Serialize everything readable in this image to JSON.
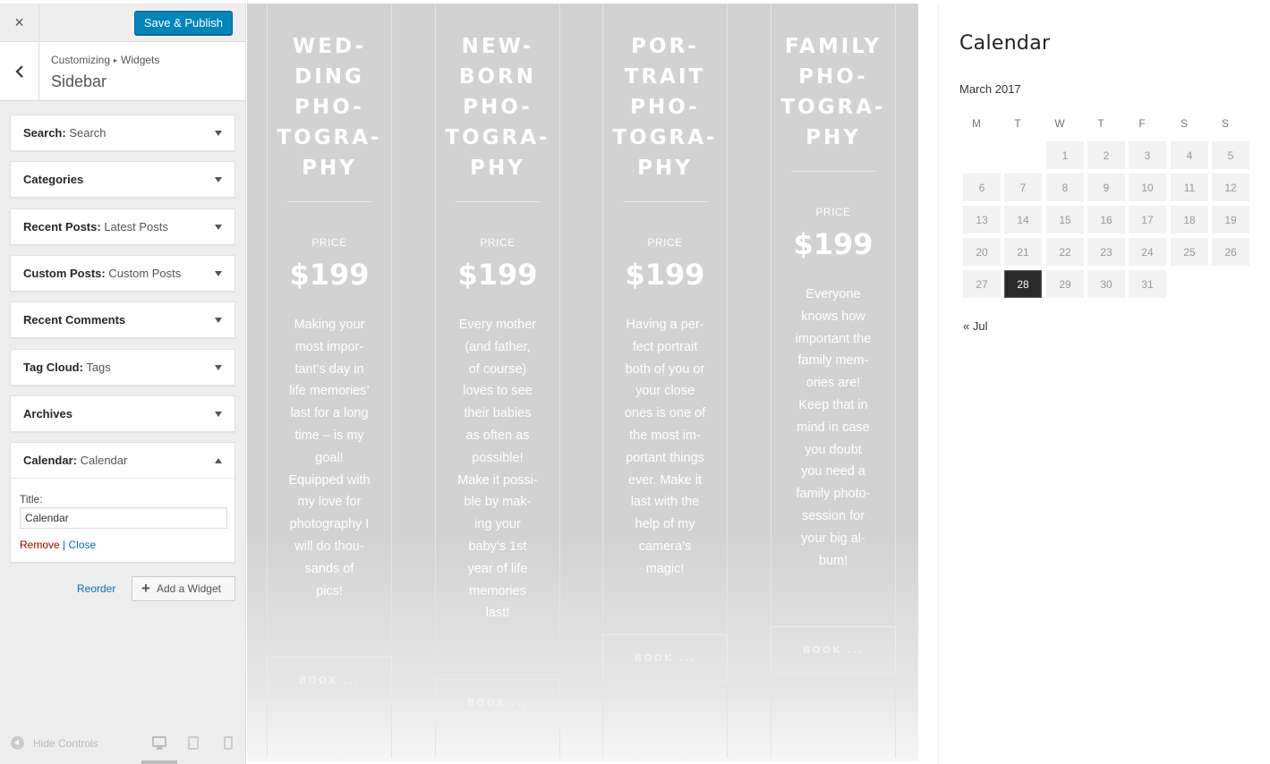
{
  "customizer": {
    "close_label": "×",
    "publish_label": "Save & Publish",
    "back_label": "‹",
    "breadcrumb": {
      "root": "Customizing",
      "separator": "▸",
      "leaf": "Widgets"
    },
    "section_title": "Sidebar",
    "widgets": [
      {
        "name": "Search:",
        "sub": "Search"
      },
      {
        "name": "Categories",
        "sub": ""
      },
      {
        "name": "Recent Posts:",
        "sub": "Latest Posts"
      },
      {
        "name": "Custom Posts:",
        "sub": "Custom Posts"
      },
      {
        "name": "Recent Comments",
        "sub": ""
      },
      {
        "name": "Tag Cloud:",
        "sub": "Tags"
      },
      {
        "name": "Archives",
        "sub": ""
      },
      {
        "name": "Calendar:",
        "sub": "Calendar"
      }
    ],
    "expanded_widget": {
      "title_label": "Title:",
      "title_value": "Calendar",
      "remove_label": "Remove",
      "separator": "|",
      "close_label": "Close"
    },
    "reorder_label": "Reorder",
    "add_widget_label": "Add a Widget",
    "add_widget_icon": "+",
    "hide_controls_label": "Hide Controls",
    "accent_color": "#0085ba"
  },
  "pricing": {
    "columns": [
      {
        "title_lines": [
          "WED-",
          "DING",
          "PHO-",
          "TOGRA-",
          "PHY"
        ],
        "price_label": "PRICE",
        "price": "$199",
        "desc_lines": [
          "Making your",
          "most impor-",
          "tant’s day in",
          "life memories’",
          "last for a long",
          "time – is my",
          "goal!",
          "Equipped with",
          "my love for",
          "photography I",
          "will do thou-",
          "sands of",
          "pics!"
        ],
        "button": "BOOK ..."
      },
      {
        "title_lines": [
          "NEW-",
          "BORN",
          "PHO-",
          "TOGRA-",
          "PHY"
        ],
        "price_label": "PRICE",
        "price": "$199",
        "desc_lines": [
          "Every mother",
          "(and father,",
          "of course)",
          "loves to see",
          "their babies",
          "as often as",
          "possible!",
          "Make it possi-",
          "ble by mak-",
          "ing your",
          "baby’s 1st",
          "year of life",
          "memories",
          "last!"
        ],
        "button": "BOOK ..."
      },
      {
        "title_lines": [
          "POR-",
          "TRAIT",
          "PHO-",
          "TOGRA-",
          "PHY"
        ],
        "price_label": "PRICE",
        "price": "$199",
        "desc_lines": [
          "Having a per-",
          "fect portrait",
          "both of you or",
          "your close",
          "ones is one of",
          "the most im-",
          "portant things",
          "ever. Make it",
          "last with the",
          "help of my",
          "camera’s",
          "magic!"
        ],
        "button": "BOOK ..."
      },
      {
        "title_lines": [
          "FAMILY",
          "PHO-",
          "TOGRA-",
          "PHY"
        ],
        "price_label": "PRICE",
        "price": "$199",
        "desc_lines": [
          "Everyone",
          "knows how",
          "important the",
          "family mem-",
          "ories are!",
          "Keep that in",
          "mind in case",
          "you doubt",
          "you need a",
          "family photo-",
          "session for",
          "your big al-",
          "bum!"
        ],
        "button": "BOOK ..."
      }
    ]
  },
  "calendar": {
    "title": "Calendar",
    "month": "March 2017",
    "weekdays": [
      "M",
      "T",
      "W",
      "T",
      "F",
      "S",
      "S"
    ],
    "first_weekday_index": 2,
    "days": [
      "1",
      "2",
      "3",
      "4",
      "5",
      "6",
      "7",
      "8",
      "9",
      "10",
      "11",
      "12",
      "13",
      "14",
      "15",
      "16",
      "17",
      "18",
      "19",
      "20",
      "21",
      "22",
      "23",
      "24",
      "25",
      "26",
      "27",
      "28",
      "29",
      "30",
      "31"
    ],
    "today": "28",
    "prev_link": "« Jul"
  }
}
